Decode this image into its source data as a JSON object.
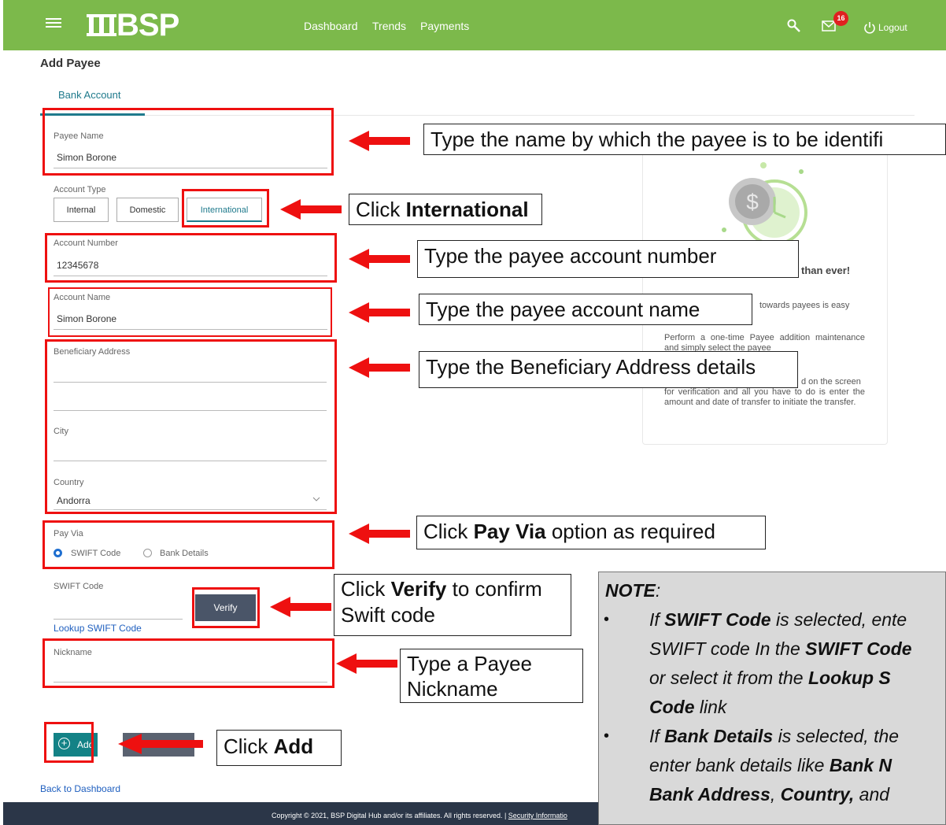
{
  "header": {
    "logo_text": "BSP",
    "nav": [
      "Dashboard",
      "Trends",
      "Payments"
    ],
    "mail_badge": "16",
    "logout": "Logout"
  },
  "page": {
    "title": "Add Payee",
    "tab": "Bank Account"
  },
  "form": {
    "payee_name": {
      "label": "Payee Name",
      "value": "Simon Borone"
    },
    "account_type": {
      "label": "Account Type",
      "options": [
        "Internal",
        "Domestic",
        "International"
      ],
      "selected": "International"
    },
    "account_number": {
      "label": "Account Number",
      "value": "12345678"
    },
    "account_name": {
      "label": "Account Name",
      "value": "Simon Borone"
    },
    "beneficiary_address": {
      "label": "Beneficiary Address"
    },
    "city": {
      "label": "City"
    },
    "country": {
      "label": "Country",
      "value": "Andorra"
    },
    "pay_via": {
      "label": "Pay Via",
      "options": [
        "SWIFT Code",
        "Bank Details"
      ],
      "selected": "SWIFT Code"
    },
    "swift_code": {
      "label": "SWIFT Code"
    },
    "verify": "Verify",
    "lookup": "Lookup SWIFT Code",
    "nickname": {
      "label": "Nickname"
    },
    "add": "Add"
  },
  "side_card": {
    "heading_fragment": "than ever!",
    "line1_fragment": "towards payees is easy",
    "para2": "Perform a one-time Payee addition maintenance and simply select the payee",
    "para3_fragment": "d on the screen",
    "para3_rest": "for verification and all you have to do is enter the amount and date of transfer to initiate the transfer."
  },
  "back_link": "Back to Dashboard",
  "footer": {
    "text": "Copyright © 2021, BSP Digital Hub and/or its affiliates. All rights reserved. | ",
    "link": "Security Informatio"
  },
  "callouts": {
    "payee_name": "Type the name by which the payee is to be identifi",
    "international_prefix": "Click ",
    "international_bold": "International",
    "account_number": "Type the payee account number",
    "account_name": "Type the payee account name",
    "beneficiary": "Type the Beneficiary Address details",
    "pay_via_prefix": "Click ",
    "pay_via_bold": "Pay Via",
    "pay_via_suffix": " option as required",
    "verify_prefix": "Click ",
    "verify_bold": "Verify",
    "verify_suffix": " to confirm",
    "verify_line2": "Swift code",
    "nickname_line1": "Type a Payee",
    "nickname_line2": "Nickname",
    "add_prefix": "Click ",
    "add_bold": "Add"
  },
  "note": {
    "title": "NOTE",
    "title_colon": ":",
    "b1_pre": "If ",
    "b1_bold1": "SWIFT Code",
    "b1_mid": " is selected, ente",
    "b1_line2_pre": "SWIFT code In the ",
    "b1_line2_bold": "SWIFT Code",
    "b1_line3_pre": "or select it from the ",
    "b1_line3_bold": "Lookup S",
    "b1_line4_bold": "Code",
    "b1_line4_post": " link",
    "b2_pre": "If ",
    "b2_bold1": "Bank Details",
    "b2_mid": " is selected, the",
    "b2_line2_pre": "enter bank details like ",
    "b2_line2_bold": "Bank N",
    "b2_line3_bold1": "Bank Address",
    "b2_line3_sep": ", ",
    "b2_line3_bold2": "Country,",
    "b2_line3_post": " and "
  },
  "colors": {
    "header_green": "#7cb94b",
    "accent_teal": "#1f7a8c",
    "annotation_red": "#ee1010",
    "footer_navy": "#2b3648"
  }
}
